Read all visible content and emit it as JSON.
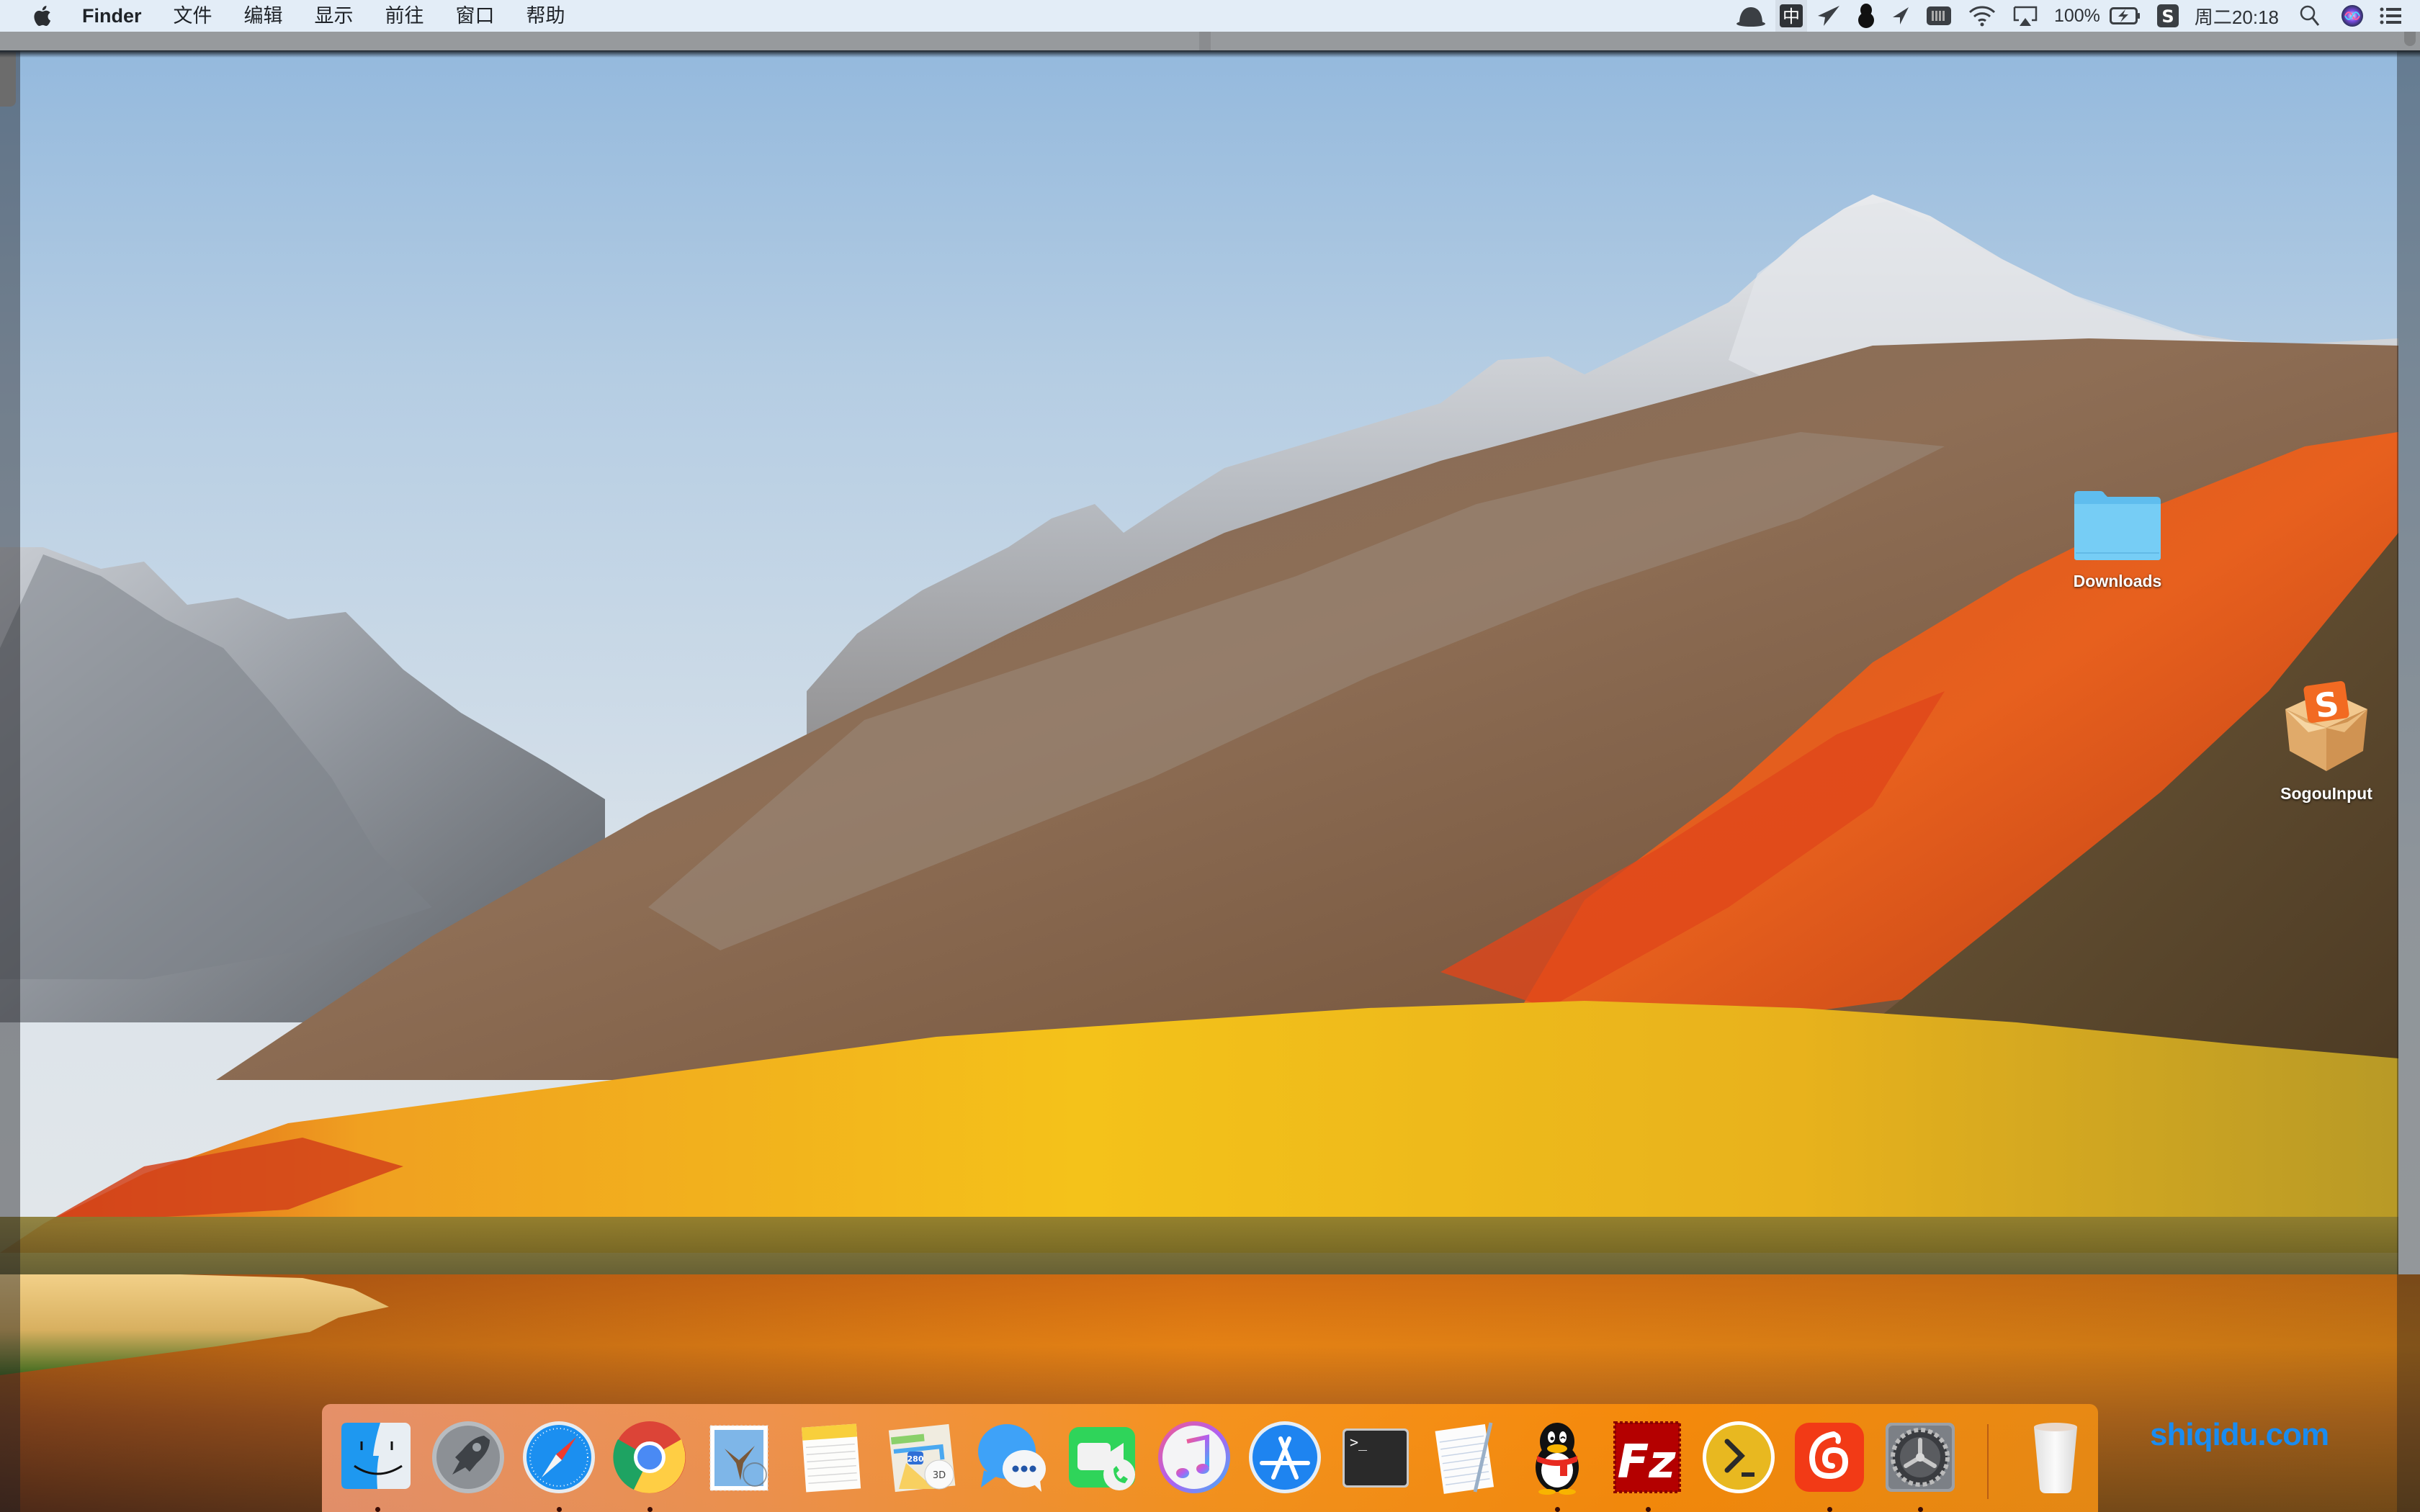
{
  "menubar": {
    "apple_icon": "apple-logo-icon",
    "app_name": "Finder",
    "menus": [
      "文件",
      "编辑",
      "显示",
      "前往",
      "窗口",
      "帮助"
    ],
    "status_icons": [
      {
        "name": "cloud-hat-icon"
      },
      {
        "name": "input-method-icon",
        "text": "中"
      },
      {
        "name": "paper-plane-icon"
      },
      {
        "name": "qq-penguin-icon"
      },
      {
        "name": "location-arrow-icon"
      },
      {
        "name": "memory-meter-icon"
      },
      {
        "name": "wifi-icon"
      },
      {
        "name": "airplay-icon"
      }
    ],
    "battery_percent": "100%",
    "battery_icon": "battery-charging-icon",
    "sogou_icon": "sogou-s-icon",
    "clock": "周二20:18",
    "spotlight_icon": "spotlight-search-icon",
    "siri_icon": "siri-icon",
    "notification_icon": "notification-center-icon"
  },
  "desktop": {
    "icons": [
      {
        "label": "Downloads",
        "icon": "folder-icon"
      },
      {
        "label": "SogouInput",
        "icon": "sogou-package-icon"
      }
    ]
  },
  "dock": {
    "apps": [
      {
        "name": "Finder",
        "icon": "finder-icon",
        "running": true
      },
      {
        "name": "Launchpad",
        "icon": "launchpad-rocket-icon",
        "running": false
      },
      {
        "name": "Safari",
        "icon": "safari-compass-icon",
        "running": true
      },
      {
        "name": "Google Chrome",
        "icon": "chrome-icon",
        "running": true
      },
      {
        "name": "Mail",
        "icon": "mail-stamp-icon",
        "running": false
      },
      {
        "name": "Notes",
        "icon": "notes-icon",
        "running": false
      },
      {
        "name": "Maps",
        "icon": "maps-icon",
        "running": false
      },
      {
        "name": "Messages",
        "icon": "messages-icon",
        "running": false
      },
      {
        "name": "FaceTime",
        "icon": "facetime-icon",
        "running": false
      },
      {
        "name": "iTunes",
        "icon": "itunes-icon",
        "running": false
      },
      {
        "name": "App Store",
        "icon": "app-store-icon",
        "running": false
      },
      {
        "name": "Terminal",
        "icon": "terminal-icon",
        "running": false
      },
      {
        "name": "TextEdit",
        "icon": "textedit-icon",
        "running": false
      },
      {
        "name": "QQ",
        "icon": "qq-icon",
        "running": true
      },
      {
        "name": "FileZilla",
        "icon": "filezilla-icon",
        "running": true
      },
      {
        "name": "Shell",
        "icon": "shell-prompt-icon",
        "running": false
      },
      {
        "name": "NetEase Music",
        "icon": "netease-music-icon",
        "running": true
      },
      {
        "name": "System Preferences",
        "icon": "system-preferences-gear-icon",
        "running": true
      }
    ],
    "trash": {
      "name": "Trash",
      "icon": "trash-icon"
    },
    "terminal_prompt": ">_",
    "maps_shield": "280",
    "maps_3d": "3D",
    "filezilla_text": "Fz"
  },
  "watermark": "shiqidu.com",
  "colors": {
    "menubar_bg": "#e3edf7",
    "folder_blue": "#62c3f2",
    "watermark_blue": "#1a8cf0",
    "running_dot": "#3a0d06"
  }
}
